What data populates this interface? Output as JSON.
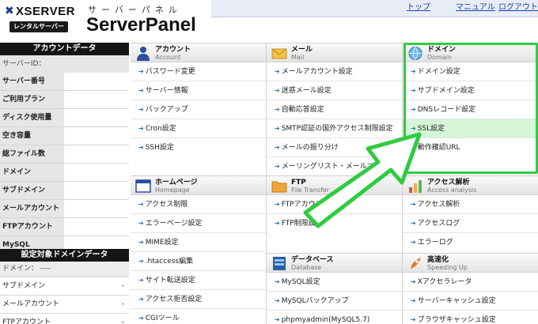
{
  "header": {
    "brand": "XSERVER",
    "brand_sub": "レンタルサーバー",
    "ruby": "サーバーパネル",
    "product": "ServerPanel",
    "links": [
      "トップ",
      "マニュアル",
      "ログアウト"
    ]
  },
  "sidebar": {
    "account_head": "アカウントデータ",
    "account_rows": [
      {
        "label": "サーバーID："
      },
      {
        "label": "サーバー番号"
      },
      {
        "label": "ご利用プラン"
      },
      {
        "label": "ディスク使用量"
      },
      {
        "label": "空き容量"
      },
      {
        "label": "総ファイル数"
      },
      {
        "label": "ドメイン"
      },
      {
        "label": "サブドメイン"
      },
      {
        "label": "メールアカウント"
      },
      {
        "label": "FTPアカウント"
      },
      {
        "label": "MySQL"
      }
    ],
    "domain_head": "設定対象ドメインデータ",
    "domain_label": "ドメイン：",
    "domain_value": "----",
    "domain_rows": [
      {
        "label": "サブドメイン",
        "value": "-"
      },
      {
        "label": "メールアカウント",
        "value": "-"
      },
      {
        "label": "FTPアカウント",
        "value": "-"
      }
    ]
  },
  "panels": {
    "account": {
      "title": "アカウント",
      "sub": "Account",
      "items": [
        "パスワード変更",
        "サーバー情報",
        "バックアップ",
        "Cron設定",
        "SSH設定"
      ]
    },
    "mail": {
      "title": "メール",
      "sub": "Mail",
      "items": [
        "メールアカウント設定",
        "迷惑メール設定",
        "自動応答設定",
        "SMTP認証の国外アクセス制限設定",
        "メールの振り分け",
        "メーリングリスト・メールマガジン"
      ]
    },
    "domain": {
      "title": "ドメイン",
      "sub": "Domain",
      "items": [
        "ドメイン設定",
        "サブドメイン設定",
        "DNSレコード設定",
        "SSL設定",
        "動作確認URL"
      ]
    },
    "homepage": {
      "title": "ホームページ",
      "sub": "Homepage",
      "items": [
        "アクセス制限",
        "エラーページ設定",
        "MIME設定",
        ".htaccess編集",
        "サイト転送設定",
        "アクセス拒否設定",
        "CGIツール"
      ]
    },
    "ftp": {
      "title": "FTP",
      "sub": "File Transfer",
      "items": [
        "FTPアカウント設定",
        "FTP制限設定"
      ]
    },
    "access": {
      "title": "アクセス解析",
      "sub": "Access analysis",
      "items": [
        "アクセス解析",
        "アクセスログ",
        "エラーログ"
      ]
    },
    "database": {
      "title": "データベース",
      "sub": "Database",
      "items": [
        "MySQL設定",
        "MySQLバックアップ",
        "phpmyadmin(MySQL5.7)"
      ]
    },
    "speed": {
      "title": "高速化",
      "sub": "Speeding Up",
      "items": [
        "Xアクセラレータ",
        "サーバーキャッシュ設定",
        "ブラウザキャッシュ設定"
      ]
    }
  },
  "colors": {
    "highlight": "#2ecc40",
    "selected_row": "#d6f5d6",
    "link": "#1a44aa"
  }
}
